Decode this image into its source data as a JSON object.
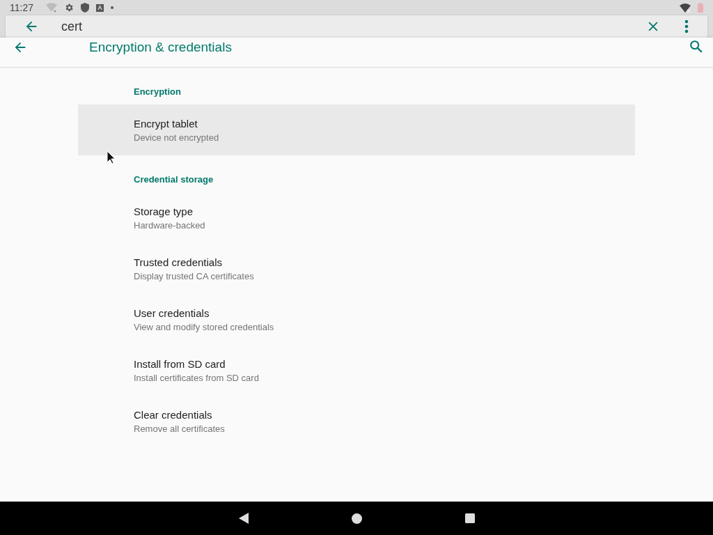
{
  "status_bar": {
    "time": "11:27",
    "notification_letter": "A"
  },
  "search": {
    "value": "cert"
  },
  "app_bar": {
    "title": "Encryption & credentials"
  },
  "sections": [
    {
      "title": "Encryption",
      "items": [
        {
          "title": "Encrypt tablet",
          "summary": "Device not encrypted",
          "selected": true
        }
      ]
    },
    {
      "title": "Credential storage",
      "items": [
        {
          "title": "Storage type",
          "summary": "Hardware-backed",
          "selected": false
        },
        {
          "title": "Trusted credentials",
          "summary": "Display trusted CA certificates",
          "selected": false
        },
        {
          "title": "User credentials",
          "summary": "View and modify stored credentials",
          "selected": false
        },
        {
          "title": "Install from SD card",
          "summary": "Install certificates from SD card",
          "selected": false
        },
        {
          "title": "Clear credentials",
          "summary": "Remove all certificates",
          "selected": false
        }
      ]
    }
  ]
}
